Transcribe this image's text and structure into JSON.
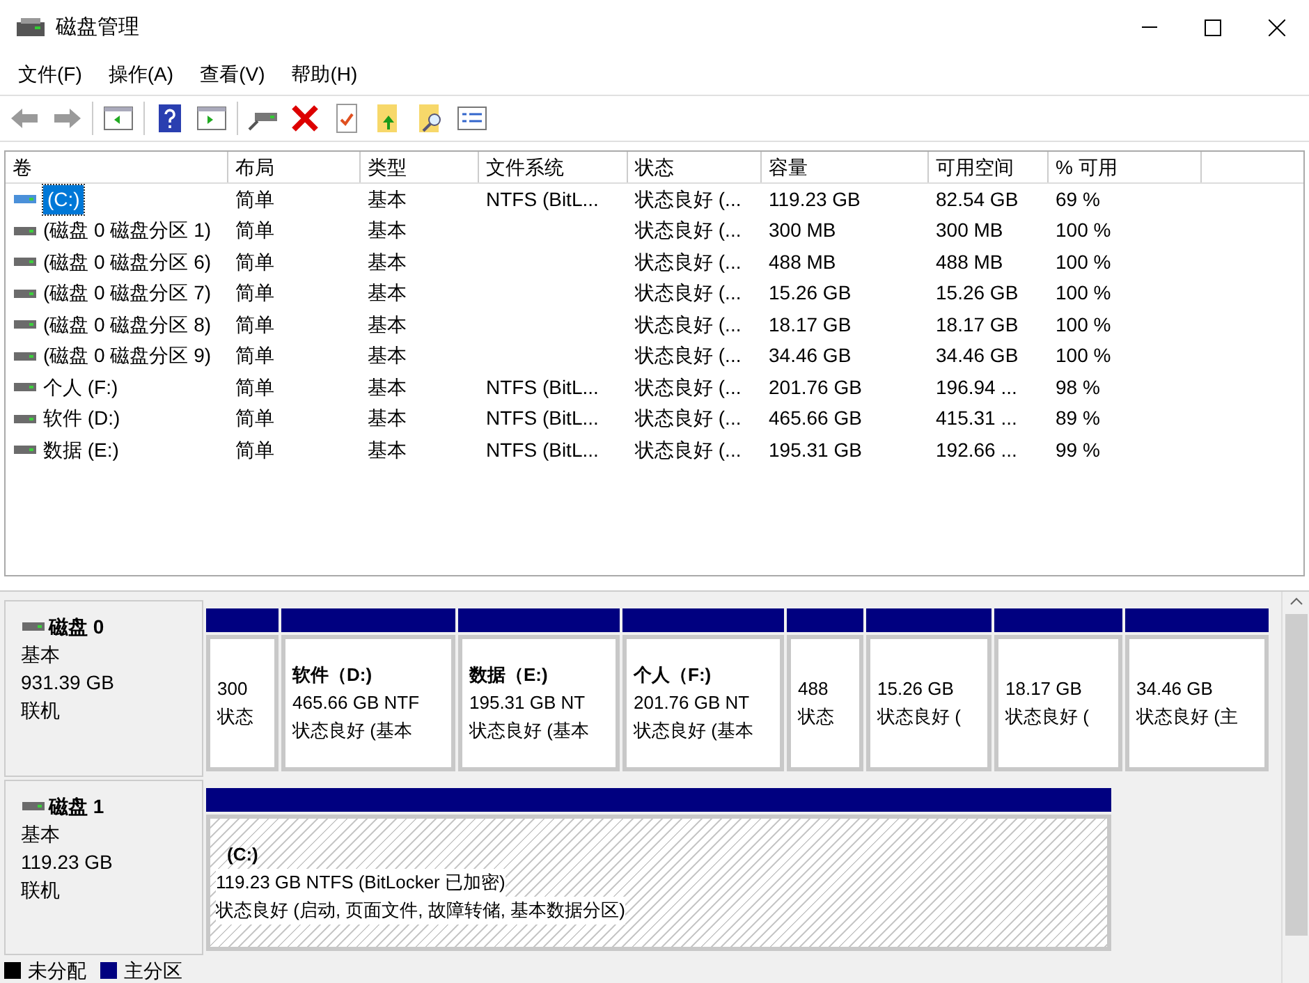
{
  "window": {
    "title": "磁盘管理"
  },
  "menu": [
    "文件(F)",
    "操作(A)",
    "查看(V)",
    "帮助(H)"
  ],
  "table": {
    "columns": [
      "卷",
      "布局",
      "类型",
      "文件系统",
      "状态",
      "容量",
      "可用空间",
      "% 可用"
    ],
    "rows": [
      {
        "selected": true,
        "cells": [
          "(C:)",
          "简单",
          "基本",
          "NTFS (BitL...",
          "状态良好 (...",
          "119.23 GB",
          "82.54 GB",
          "69 %"
        ]
      },
      {
        "selected": false,
        "cells": [
          "(磁盘 0 磁盘分区 1)",
          "简单",
          "基本",
          "",
          "状态良好 (...",
          "300 MB",
          "300 MB",
          "100 %"
        ]
      },
      {
        "selected": false,
        "cells": [
          "(磁盘 0 磁盘分区 6)",
          "简单",
          "基本",
          "",
          "状态良好 (...",
          "488 MB",
          "488 MB",
          "100 %"
        ]
      },
      {
        "selected": false,
        "cells": [
          "(磁盘 0 磁盘分区 7)",
          "简单",
          "基本",
          "",
          "状态良好 (...",
          "15.26 GB",
          "15.26 GB",
          "100 %"
        ]
      },
      {
        "selected": false,
        "cells": [
          "(磁盘 0 磁盘分区 8)",
          "简单",
          "基本",
          "",
          "状态良好 (...",
          "18.17 GB",
          "18.17 GB",
          "100 %"
        ]
      },
      {
        "selected": false,
        "cells": [
          "(磁盘 0 磁盘分区 9)",
          "简单",
          "基本",
          "",
          "状态良好 (...",
          "34.46 GB",
          "34.46 GB",
          "100 %"
        ]
      },
      {
        "selected": false,
        "cells": [
          "个人 (F:)",
          "简单",
          "基本",
          "NTFS (BitL...",
          "状态良好 (...",
          "201.76 GB",
          "196.94 ...",
          "98 %"
        ]
      },
      {
        "selected": false,
        "cells": [
          "软件 (D:)",
          "简单",
          "基本",
          "NTFS (BitL...",
          "状态良好 (...",
          "465.66 GB",
          "415.31 ...",
          "89 %"
        ]
      },
      {
        "selected": false,
        "cells": [
          "数据 (E:)",
          "简单",
          "基本",
          "NTFS (BitL...",
          "状态良好 (...",
          "195.31 GB",
          "192.66 ...",
          "99 %"
        ]
      }
    ]
  },
  "disks": [
    {
      "name": "磁盘 0",
      "type": "基本",
      "size": "931.39 GB",
      "status": "联机",
      "partitions": [
        {
          "selected": false,
          "size": "300",
          "status": "状态"
        },
        {
          "selected": false,
          "name": "软件（D:)",
          "size": "465.66 GB NTF",
          "status": "状态良好 (基本"
        },
        {
          "selected": false,
          "name": "数据（E:)",
          "size": "195.31 GB NT",
          "status": "状态良好 (基本"
        },
        {
          "selected": false,
          "name": "个人（F:)",
          "size": "201.76 GB NT",
          "status": "状态良好 (基本"
        },
        {
          "selected": false,
          "size": "488",
          "status": "状态"
        },
        {
          "selected": false,
          "size": "15.26 GB",
          "status": "状态良好 ("
        },
        {
          "selected": false,
          "size": "18.17 GB",
          "status": "状态良好 ("
        },
        {
          "selected": false,
          "size": "34.46 GB",
          "status": "状态良好 (主"
        }
      ]
    },
    {
      "name": "磁盘 1",
      "type": "基本",
      "size": "119.23 GB",
      "status": "联机",
      "partitions": [
        {
          "selected": true,
          "name": "(C:)",
          "size": "119.23 GB NTFS (BitLocker 已加密)",
          "status": "状态良好 (启动, 页面文件, 故障转储, 基本数据分区)"
        }
      ]
    }
  ],
  "legend": [
    {
      "label": "未分配",
      "color": "#000000"
    },
    {
      "label": "主分区",
      "color": "#000080"
    }
  ]
}
